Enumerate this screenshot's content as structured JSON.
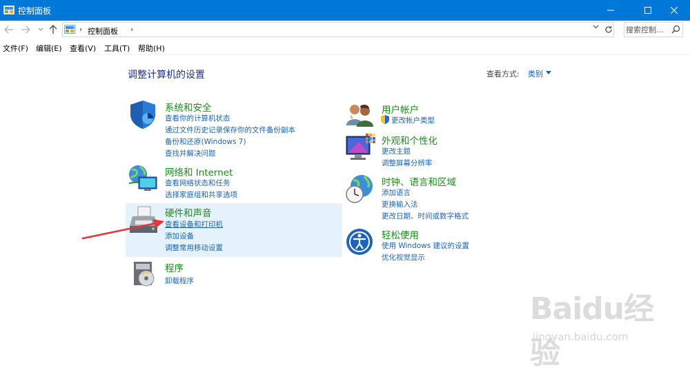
{
  "window": {
    "title": "控制面板"
  },
  "address": {
    "crumb": "控制面板",
    "search_placeholder": "搜索控制..."
  },
  "menu": [
    "文件(F)",
    "编辑(E)",
    "查看(V)",
    "工具(T)",
    "帮助(H)"
  ],
  "main": {
    "heading": "调整计算机的设置",
    "view_by_label": "查看方式:",
    "view_by_value": "类别"
  },
  "categories": [
    {
      "title": "系统和安全",
      "icon": "shield-icon",
      "links": [
        "查看你的计算机状态",
        "通过文件历史记录保存你的文件备份副本",
        "备份和还原(Windows 7)",
        "查找并解决问题"
      ]
    },
    {
      "title": "网络和 Internet",
      "icon": "network-globe-icon",
      "links": [
        "查看网络状态和任务",
        "选择家庭组和共享选项"
      ]
    },
    {
      "title": "硬件和声音",
      "icon": "printer-icon",
      "links": [
        "查看设备和打印机",
        "添加设备",
        "调整常用移动设置"
      ]
    },
    {
      "title": "程序",
      "icon": "programs-disc-icon",
      "links": [
        "卸载程序"
      ]
    },
    {
      "title": "用户帐户",
      "icon": "users-icon",
      "links": [
        "更改帐户类型"
      ]
    },
    {
      "title": "外观和个性化",
      "icon": "monitor-palette-icon",
      "links": [
        "更改主题",
        "调整屏幕分辨率"
      ]
    },
    {
      "title": "时钟、语言和区域",
      "icon": "clock-globe-icon",
      "links": [
        "添加语言",
        "更换输入法",
        "更改日期、时间或数字格式"
      ]
    },
    {
      "title": "轻松使用",
      "icon": "ease-of-access-icon",
      "links": [
        "使用 Windows 建议的设置",
        "优化视觉显示"
      ]
    }
  ],
  "watermark": {
    "logo": "Baidu经验",
    "sub": "jingyan.baidu.com"
  },
  "colors": {
    "titlebar": "#0078d7",
    "category_title": "#1a8c1a",
    "link": "#1c64b4",
    "heading": "#1e3287",
    "highlight": "#e5f1fb",
    "arrow": "#e8333a"
  }
}
